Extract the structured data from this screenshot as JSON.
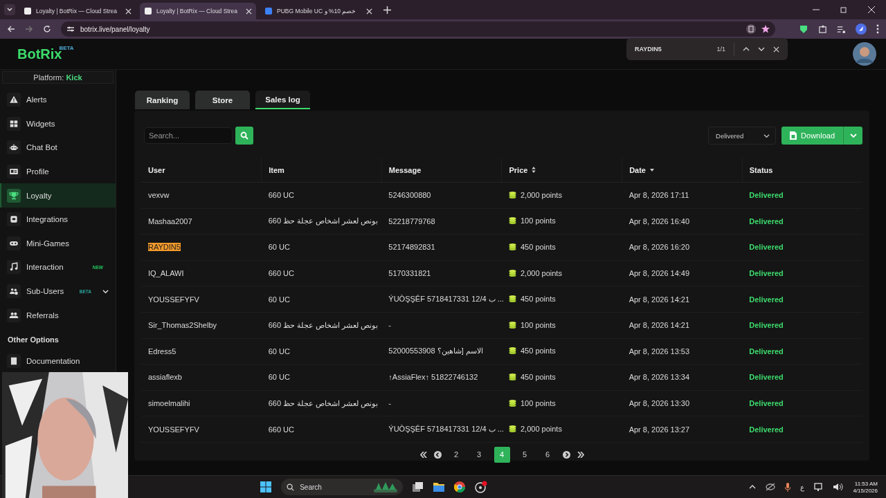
{
  "browser": {
    "tabs": [
      {
        "title": "Loyalty | BotRix — Cloud Strea",
        "selected": false
      },
      {
        "title": "Loyalty | BotRix — Cloud Strea",
        "selected": true
      },
      {
        "title": "PUBG Mobile UC خصم 10% و",
        "selected": false
      }
    ],
    "url": "botrix.live/panel/loyalty",
    "find_bar": {
      "query": "RAYDIN5",
      "count": "1/1"
    }
  },
  "logo": {
    "name": "BotRix",
    "badge": "BETA"
  },
  "sidebar": {
    "platform_label": "Platform:",
    "platform": "Kick",
    "items": [
      {
        "label": "Alerts",
        "selected": false
      },
      {
        "label": "Widgets",
        "selected": false
      },
      {
        "label": "Chat Bot",
        "selected": false
      },
      {
        "label": "Profile",
        "selected": false
      },
      {
        "label": "Loyalty",
        "selected": true
      },
      {
        "label": "Integrations",
        "selected": false
      },
      {
        "label": "Mini-Games",
        "selected": false
      },
      {
        "label": "Interaction",
        "selected": false,
        "badge": "NEW",
        "color": "#22c55e"
      },
      {
        "label": "Sub-Users",
        "selected": false,
        "badge": "BETA",
        "color": "#2aa39a",
        "expandable": true
      },
      {
        "label": "Referrals",
        "selected": false
      }
    ],
    "section": "Other Options",
    "section_items": [
      {
        "label": "Documentation"
      }
    ]
  },
  "tabs": [
    {
      "label": "Ranking",
      "selected": false
    },
    {
      "label": "Store",
      "selected": false
    },
    {
      "label": "Sales log",
      "selected": true
    }
  ],
  "search": {
    "placeholder": "Search..."
  },
  "filter": {
    "value": "Delivered"
  },
  "download": {
    "label": "Download"
  },
  "table": {
    "columns": [
      {
        "label": "User",
        "sortable": false,
        "sorted": false
      },
      {
        "label": "Item",
        "sortable": false,
        "sorted": false
      },
      {
        "label": "Message",
        "sortable": false,
        "sorted": false
      },
      {
        "label": "Price",
        "sortable": true,
        "sorted": false
      },
      {
        "label": "Date",
        "sortable": true,
        "sorted": true
      },
      {
        "label": "Status",
        "sortable": false,
        "sorted": false
      }
    ],
    "rows": [
      {
        "user": "vexvw",
        "item": "660 UC",
        "message": "5246300880",
        "price": "2,000 points",
        "date": "Apr 8, 2026 17:11",
        "status": "Delivered",
        "highlighted": false
      },
      {
        "user": "Mashaa2007",
        "item": "660 بونص لعشر اشخاص عجلة حظ",
        "message": "52218779768",
        "price": "100 points",
        "date": "Apr 8, 2026 16:40",
        "status": "Delivered",
        "highlighted": false
      },
      {
        "user": "RAYDIN5",
        "item": "60 UC",
        "message": "52174892831",
        "price": "450 points",
        "date": "Apr 8, 2026 16:20",
        "status": "Delivered",
        "highlighted": true
      },
      {
        "user": "IQ_ALAWI",
        "item": "660 UC",
        "message": "5170331821",
        "price": "2,000 points",
        "date": "Apr 8, 2026 14:49",
        "status": "Delivered",
        "highlighted": false
      },
      {
        "user": "YOUSSEFYFV",
        "item": "60 UC",
        "message": "ÝUÒŞŞÊF 5718417331 12/4 ب ...",
        "price": "450 points",
        "date": "Apr 8, 2026 14:21",
        "status": "Delivered",
        "highlighted": false
      },
      {
        "user": "Sir_Thomas2Shelby",
        "item": "660 بونص لعشر اشخاص عجلة حظ",
        "message": "-",
        "price": "100 points",
        "date": "Apr 8, 2026 14:21",
        "status": "Delivered",
        "highlighted": false
      },
      {
        "user": "Edress5",
        "item": "60 UC",
        "message": "52000553908 الاسم [شاهين؟",
        "price": "450 points",
        "date": "Apr 8, 2026 13:53",
        "status": "Delivered",
        "highlighted": false
      },
      {
        "user": "assiaflexb",
        "item": "60 UC",
        "message": "↑AssiaFlex↑ 51822746132",
        "price": "450 points",
        "date": "Apr 8, 2026 13:34",
        "status": "Delivered",
        "highlighted": false
      },
      {
        "user": "simoelmalihi",
        "item": "660 بونص لعشر اشخاص عجلة حظ",
        "message": "-",
        "price": "100 points",
        "date": "Apr 8, 2026 13:30",
        "status": "Delivered",
        "highlighted": false
      },
      {
        "user": "YOUSSEFYFV",
        "item": "660 UC",
        "message": "ÝUÒŞŞÊF 5718417331 12/4 ب ...",
        "price": "2,000 points",
        "date": "Apr 8, 2026 13:27",
        "status": "Delivered",
        "highlighted": false
      }
    ]
  },
  "pagination": [
    {
      "label": "2",
      "selected": false
    },
    {
      "label": "3",
      "selected": false
    },
    {
      "label": "4",
      "selected": true
    },
    {
      "label": "5",
      "selected": false
    },
    {
      "label": "6",
      "selected": false
    }
  ],
  "taskbar": {
    "search": "Search",
    "language": "ع",
    "time": "11:53 AM",
    "date": "4/15/2026"
  }
}
